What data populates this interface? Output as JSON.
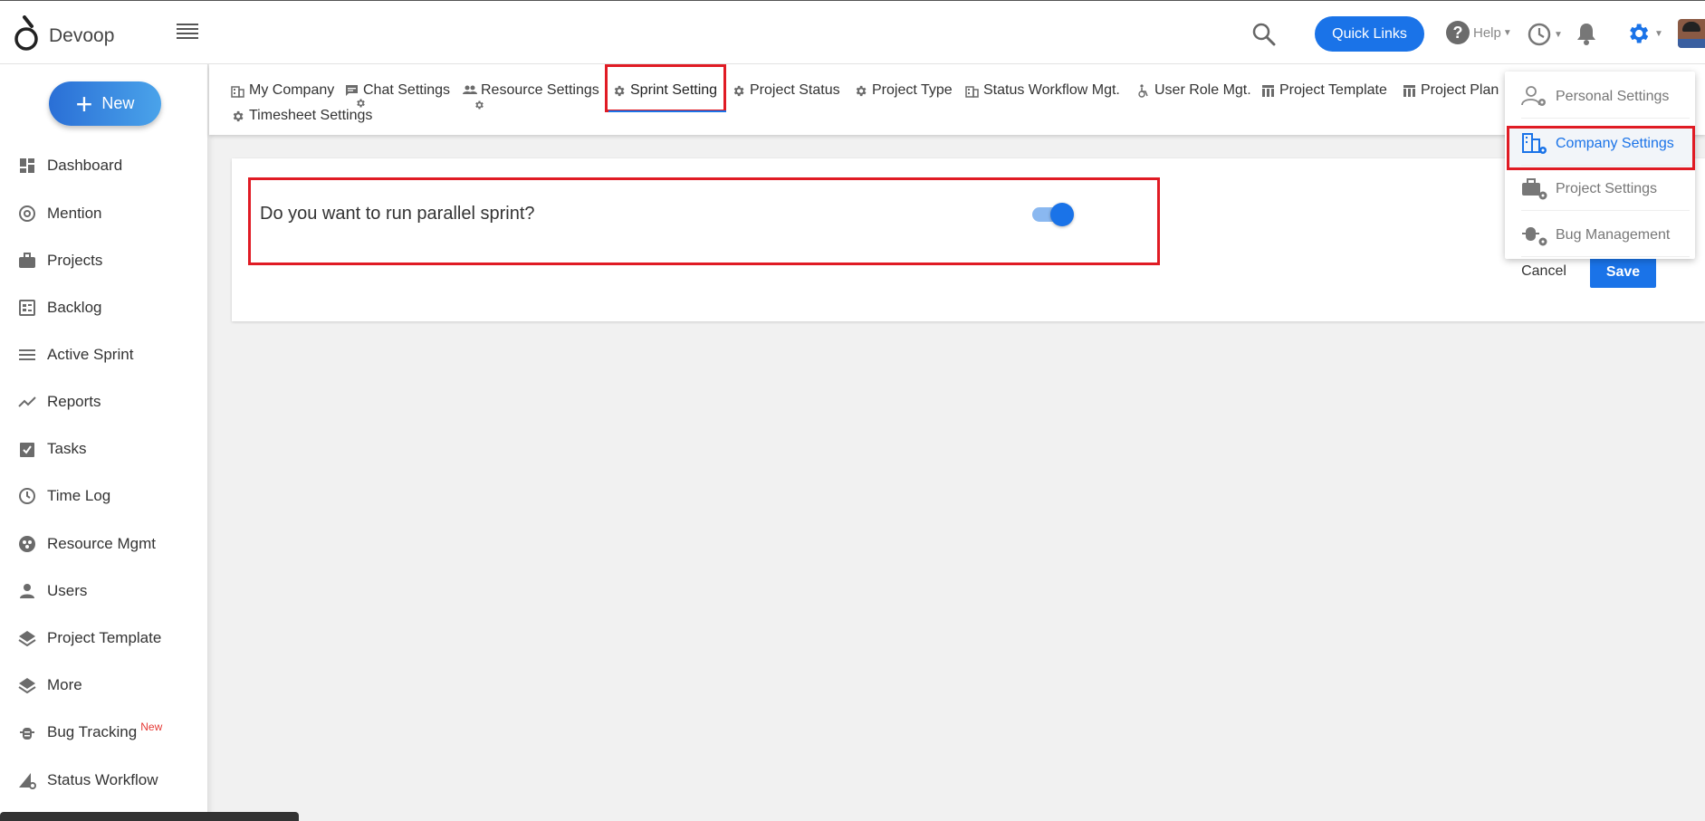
{
  "header": {
    "brand": "Devoop",
    "quick_links": "Quick Links",
    "help": "Help"
  },
  "sidebar": {
    "new_label": "New",
    "items": [
      {
        "label": "Dashboard",
        "icon": "dashboard-icon"
      },
      {
        "label": "Mention",
        "icon": "at-icon"
      },
      {
        "label": "Projects",
        "icon": "briefcase-icon"
      },
      {
        "label": "Backlog",
        "icon": "backlog-icon"
      },
      {
        "label": "Active Sprint",
        "icon": "lines-icon"
      },
      {
        "label": "Reports",
        "icon": "trend-icon"
      },
      {
        "label": "Tasks",
        "icon": "clipboard-check-icon"
      },
      {
        "label": "Time Log",
        "icon": "clock-icon"
      },
      {
        "label": "Resource Mgmt",
        "icon": "resource-icon"
      },
      {
        "label": "Users",
        "icon": "user-icon"
      },
      {
        "label": "Project Template",
        "icon": "layers-icon"
      },
      {
        "label": "More",
        "icon": "layers-icon"
      },
      {
        "label": "Bug Tracking",
        "icon": "bug-icon",
        "badge": "New"
      },
      {
        "label": "Status Workflow",
        "icon": "workflow-icon"
      }
    ]
  },
  "tabs": [
    {
      "label": "My Company",
      "icon": "building-icon"
    },
    {
      "label": "Chat Settings",
      "icon": "chat-gear-icon"
    },
    {
      "label": "Resource Settings",
      "icon": "people-gear-icon"
    },
    {
      "label": "Sprint Setting",
      "icon": "gear-icon",
      "active": true
    },
    {
      "label": "Project Status",
      "icon": "gear-icon"
    },
    {
      "label": "Project Type",
      "icon": "gear-icon"
    },
    {
      "label": "Status Workflow Mgt.",
      "icon": "building-icon"
    },
    {
      "label": "User Role Mgt.",
      "icon": "accessible-icon"
    },
    {
      "label": "Project Template",
      "icon": "table-icon"
    },
    {
      "label": "Project Plan",
      "icon": "table-icon"
    },
    {
      "label": "Timesheet Settings",
      "icon": "gear-icon"
    }
  ],
  "content": {
    "question": "Do you want to run parallel sprint?",
    "toggle_on": true,
    "cancel": "Cancel",
    "save": "Save"
  },
  "settings_menu": {
    "items": [
      {
        "label": "Personal Settings",
        "icon": "person-gear-icon"
      },
      {
        "label": "Company Settings",
        "icon": "building-gear-icon",
        "active": true
      },
      {
        "label": "Project Settings",
        "icon": "briefcase-gear-icon"
      },
      {
        "label": "Bug Management",
        "icon": "bug-gear-icon"
      }
    ]
  },
  "colors": {
    "accent": "#1a73e8",
    "highlight": "#e01b24",
    "new_badge": "#e53935"
  }
}
